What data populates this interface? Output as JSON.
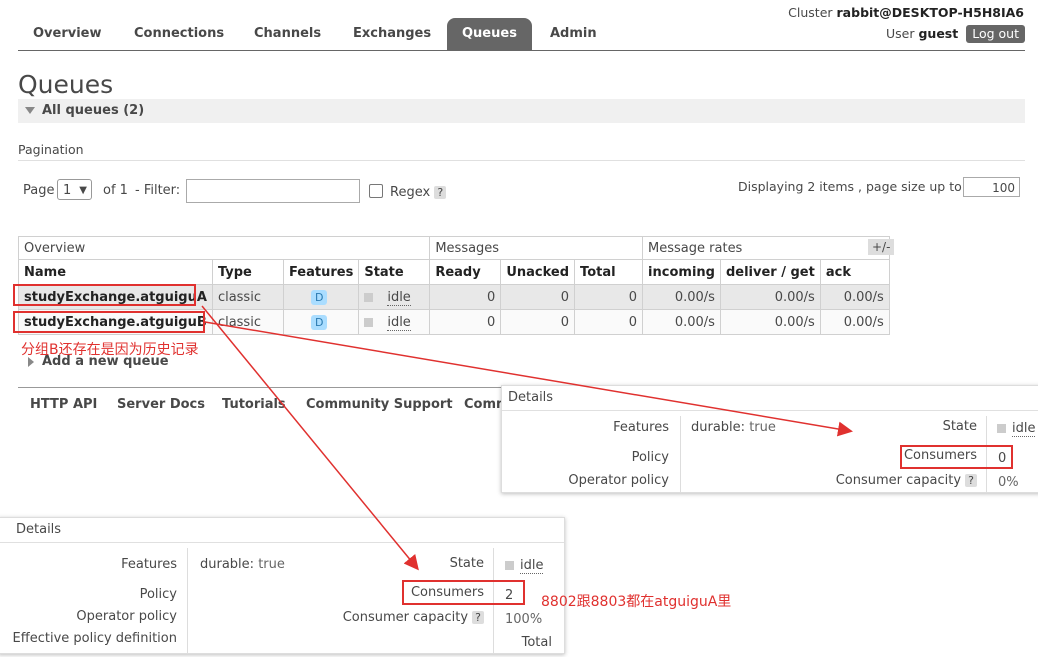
{
  "header": {
    "cluster_label": "Cluster",
    "cluster_name": "rabbit@DESKTOP-H5H8IA6",
    "user_label": "User",
    "user_name": "guest",
    "logout_label": "Log out"
  },
  "nav": {
    "tabs": [
      {
        "label": "Overview"
      },
      {
        "label": "Connections"
      },
      {
        "label": "Channels"
      },
      {
        "label": "Exchanges"
      },
      {
        "label": "Queues",
        "active": true
      },
      {
        "label": "Admin"
      }
    ]
  },
  "page": {
    "title": "Queues",
    "section_title": "All queues (2)"
  },
  "pagination": {
    "section_label": "Pagination",
    "page_label": "Page",
    "page_value": "1",
    "of_label": "of 1",
    "filter_label": "- Filter:",
    "filter_value": "",
    "regex_label": "Regex",
    "help_label": "?",
    "displaying_text": "Displaying 2 items , page size up to:",
    "page_size": "100"
  },
  "table": {
    "group_headers": [
      "Overview",
      "Messages",
      "Message rates"
    ],
    "toggle_label": "+/-",
    "columns": [
      "Name",
      "Type",
      "Features",
      "State",
      "Ready",
      "Unacked",
      "Total",
      "incoming",
      "deliver / get",
      "ack"
    ],
    "rows": [
      {
        "name": "studyExchange.atguiguA",
        "type": "classic",
        "features": "D",
        "state": "idle",
        "ready": "0",
        "unacked": "0",
        "total": "0",
        "incoming": "0.00/s",
        "deliver_get": "0.00/s",
        "ack": "0.00/s"
      },
      {
        "name": "studyExchange.atguiguB",
        "type": "classic",
        "features": "D",
        "state": "idle",
        "ready": "0",
        "unacked": "0",
        "total": "0",
        "incoming": "0.00/s",
        "deliver_get": "0.00/s",
        "ack": "0.00/s"
      }
    ]
  },
  "annotations": {
    "note_b": "分组B还存在是因为历史记录",
    "note_a": "8802跟8803都在atguiguA里",
    "color": "#e0312f"
  },
  "add_queue_label": "Add a new queue",
  "footer": {
    "links": [
      "HTTP API",
      "Server Docs",
      "Tutorials",
      "Community Support",
      "Comm"
    ]
  },
  "details_b": {
    "heading": "Details",
    "features_label": "Features",
    "features_key": "durable:",
    "features_value": "true",
    "policy_label": "Policy",
    "operator_policy_label": "Operator policy",
    "state_label": "State",
    "state_value": "idle",
    "consumers_label": "Consumers",
    "consumers_value": "0",
    "consumer_capacity_label": "Consumer capacity",
    "help_label": "?",
    "consumer_capacity_value": "0%"
  },
  "details_a": {
    "heading": "Details",
    "features_label": "Features",
    "features_key": "durable:",
    "features_value": "true",
    "policy_label": "Policy",
    "operator_policy_label": "Operator policy",
    "effective_policy_label": "Effective policy definition",
    "state_label": "State",
    "state_value": "idle",
    "consumers_label": "Consumers",
    "consumers_value": "2",
    "consumer_capacity_label": "Consumer capacity",
    "help_label": "?",
    "consumer_capacity_value": "100%",
    "total_label": "Total"
  }
}
